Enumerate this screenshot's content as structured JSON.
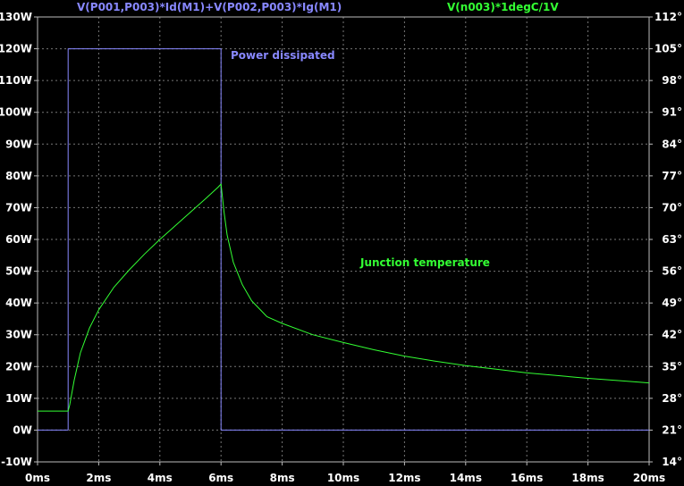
{
  "colors": {
    "background": "#000000",
    "plot_border": "#bbbbbb",
    "grid": "#777777",
    "tick_text": "#ffffff",
    "power_trace": "#8888ff",
    "temp_trace": "#33ff33"
  },
  "trace_labels": {
    "power": "V(P001,P003)*Id(M1)+V(P002,P003)*Ig(M1)",
    "temp": "V(n003)*1degC/1V"
  },
  "annotations": {
    "power": "Power dissipated",
    "temp": "Junction temperature"
  },
  "chart_data": {
    "type": "line",
    "grid": true,
    "xlim": [
      0,
      20
    ],
    "ylim_left": [
      -10,
      130
    ],
    "ylim_right": [
      14,
      112
    ],
    "x_tick_labels": [
      "0ms",
      "2ms",
      "4ms",
      "6ms",
      "8ms",
      "10ms",
      "12ms",
      "14ms",
      "16ms",
      "18ms",
      "20ms"
    ],
    "y_left_tick_labels": [
      "-10W",
      "0W",
      "10W",
      "20W",
      "30W",
      "40W",
      "50W",
      "60W",
      "70W",
      "80W",
      "90W",
      "100W",
      "110W",
      "120W",
      "130W"
    ],
    "y_right_tick_labels": [
      "14°",
      "21°",
      "28°",
      "35°",
      "42°",
      "49°",
      "56°",
      "63°",
      "70°",
      "77°",
      "84°",
      "91°",
      "98°",
      "105°",
      "112°"
    ],
    "series": [
      {
        "name": "V(P001,P003)*Id(M1)+V(P002,P003)*Ig(M1)",
        "axis": "left",
        "x_unit": "ms",
        "y_unit": "W",
        "points": [
          [
            0,
            0
          ],
          [
            1,
            0
          ],
          [
            1,
            120
          ],
          [
            6,
            120
          ],
          [
            6,
            0
          ],
          [
            20,
            0
          ]
        ]
      },
      {
        "name": "V(n003)*1degC/1V",
        "axis": "right",
        "x_unit": "ms",
        "y_unit": "°C",
        "points": [
          [
            0,
            25.2
          ],
          [
            1,
            25.2
          ],
          [
            1.05,
            26.5
          ],
          [
            1.2,
            32
          ],
          [
            1.4,
            38
          ],
          [
            1.7,
            43.5
          ],
          [
            2,
            47.5
          ],
          [
            2.5,
            52.5
          ],
          [
            3,
            56.3
          ],
          [
            3.5,
            59.8
          ],
          [
            4,
            63
          ],
          [
            4.5,
            66
          ],
          [
            5,
            69
          ],
          [
            5.5,
            72
          ],
          [
            5.9,
            74.5
          ],
          [
            6,
            75.2
          ],
          [
            6.1,
            69
          ],
          [
            6.2,
            64
          ],
          [
            6.4,
            58
          ],
          [
            6.7,
            53
          ],
          [
            7,
            49.5
          ],
          [
            7.5,
            46
          ],
          [
            8,
            44.5
          ],
          [
            9,
            42
          ],
          [
            10,
            40.3
          ],
          [
            11,
            38.7
          ],
          [
            12,
            37.3
          ],
          [
            13,
            36.2
          ],
          [
            14,
            35.2
          ],
          [
            15,
            34.4
          ],
          [
            16,
            33.6
          ],
          [
            17,
            33
          ],
          [
            18,
            32.4
          ],
          [
            19,
            31.9
          ],
          [
            20,
            31.4
          ]
        ]
      }
    ]
  }
}
